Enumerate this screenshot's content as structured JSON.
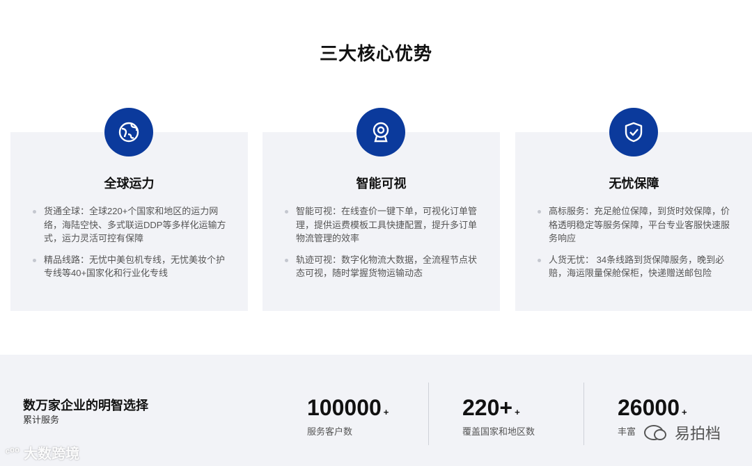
{
  "section": {
    "title": "三大核心优势"
  },
  "cards": [
    {
      "icon": "globe-icon",
      "title": "全球运力",
      "items": [
        "货通全球：全球220+个国家和地区的运力网络，海陆空快、多式联运DDP等多样化运输方式，运力灵活可控有保障",
        "精品线路：无忧中美包机专线，无忧美妆个护专线等40+国家化和行业化专线"
      ]
    },
    {
      "icon": "webcam-icon",
      "title": "智能可视",
      "items": [
        "智能可视：在线查价一键下单，可视化订单管理，提供运费模板工具快捷配置，提升多订单物流管理的效率",
        "轨迹可视：数字化物流大数据，全流程节点状态可视，随时掌握货物运输动态"
      ]
    },
    {
      "icon": "shield-check-icon",
      "title": "无忧保障",
      "items": [
        "高标服务：充足舱位保障，到货时效保障，价格透明稳定等服务保障，平台专业客服快速服务响应",
        "人货无忧： 34条线路到货保障服务，晚到必赔，海运限量保舱保柜，快递赠送邮包险"
      ]
    }
  ],
  "stats": {
    "heading": "数万家企业的明智选择",
    "subheading": "累计服务",
    "items": [
      {
        "value": "100000",
        "suffix": "+",
        "label": "服务客户数"
      },
      {
        "value": "220+",
        "suffix": "+",
        "label": "覆盖国家和地区数"
      },
      {
        "value": "26000",
        "suffix": "+",
        "label": "丰富"
      }
    ]
  },
  "watermarks": {
    "left": "大数跨境",
    "right": "易拍档"
  },
  "colors": {
    "accent": "#0b3a9c",
    "card_bg": "#f2f3f7"
  }
}
